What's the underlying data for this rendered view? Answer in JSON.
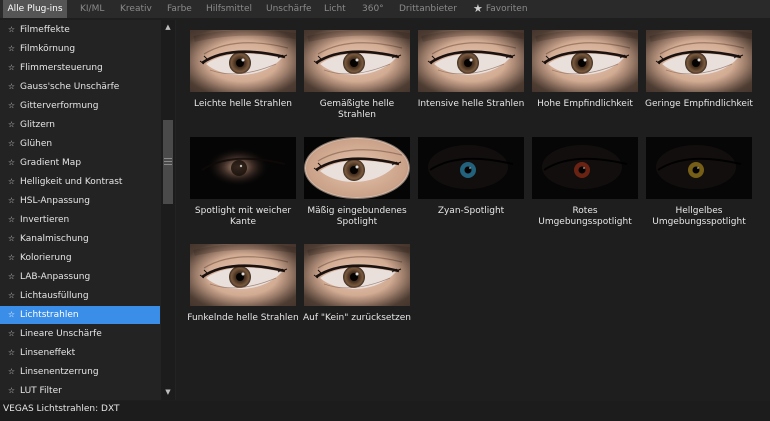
{
  "tabs": [
    {
      "label": "Alle Plug-ins",
      "active": true
    },
    {
      "label": "KI/ML"
    },
    {
      "label": "Kreativ"
    },
    {
      "label": "Farbe"
    },
    {
      "label": "Hilfsmittel"
    },
    {
      "label": "Unschärfe"
    },
    {
      "label": "Licht"
    },
    {
      "label": "360°"
    },
    {
      "label": "Drittanbieter"
    },
    {
      "label": "Favoriten",
      "icon": "star-icon"
    }
  ],
  "sidebar": {
    "selected_index": 15,
    "items": [
      "Filmeffekte",
      "Filmkörnung",
      "Flimmersteuerung",
      "Gauss'sche Unschärfe",
      "Gitterverformung",
      "Glitzern",
      "Glühen",
      "Gradient Map",
      "Helligkeit und Kontrast",
      "HSL-Anpassung",
      "Invertieren",
      "Kanalmischung",
      "Kolorierung",
      "LAB-Anpassung",
      "Lichtausfüllung",
      "Lichtstrahlen",
      "Lineare Unschärfe",
      "Linseneffekt",
      "Linsenentzerrung",
      "LUT Filter"
    ]
  },
  "presets": [
    {
      "label": "Leichte helle Strahlen",
      "style": "skin"
    },
    {
      "label": "Gemäßigte helle Strahlen",
      "style": "skin"
    },
    {
      "label": "Intensive helle Strahlen",
      "style": "skin"
    },
    {
      "label": "Hohe Empfindlichkeit",
      "style": "skin"
    },
    {
      "label": "Geringe Empfindlichkeit",
      "style": "skin"
    },
    {
      "label": "Spotlight mit weicher Kante",
      "style": "soft-spot"
    },
    {
      "label": "Mäßig eingebundenes Spotlight",
      "style": "oval"
    },
    {
      "label": "Zyan-Spotlight",
      "style": "cyan"
    },
    {
      "label": "Rotes Umgebungsspotlight",
      "style": "red"
    },
    {
      "label": "Hellgelbes Umgebungsspotlight",
      "style": "yellow"
    },
    {
      "label": "Funkelnde helle Strahlen",
      "style": "skin"
    },
    {
      "label": "Auf \"Kein\" zurücksetzen",
      "style": "skin"
    }
  ],
  "icons": {
    "favorite": "star-icon",
    "scroll_up": "scroll-up-arrow-icon",
    "scroll_down": "scroll-down-arrow-icon"
  },
  "colors": {
    "accent": "#3b8ee8",
    "active_tab": "#555555",
    "background": "#1e1e1e"
  },
  "status": {
    "text": "VEGAS Lichtstrahlen: DXT"
  }
}
